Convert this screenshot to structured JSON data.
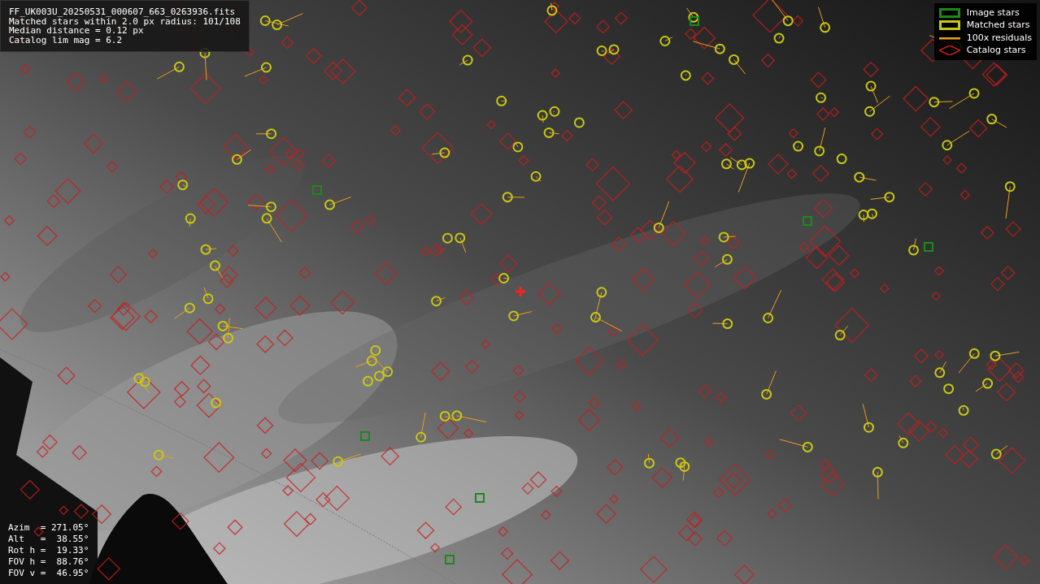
{
  "info_box": {
    "lines": [
      "FF_UK003U_20250531_000607_663_0263936.fits",
      "Matched stars within 2.0 px radius: 101/108",
      "Median distance = 0.12 px",
      "Catalog lim mag = 6.2"
    ]
  },
  "legend": [
    {
      "label": "Image stars",
      "color": "#1a8a1a"
    },
    {
      "kind": "matched",
      "label": "Matched stars",
      "color": "#c8c814"
    },
    {
      "kind": "residual",
      "label": "100x residuals",
      "color": "#e8a020"
    },
    {
      "kind": "catalog",
      "label": "Catalog stars",
      "color": "#c81e1e"
    }
  ],
  "pointing": {
    "lines": [
      "Azim  = 271.05°",
      "Alt   =  38.55°",
      "Rot h =  19.33°",
      "FOV h =  88.76°",
      "FOV v =  46.95°"
    ]
  }
}
